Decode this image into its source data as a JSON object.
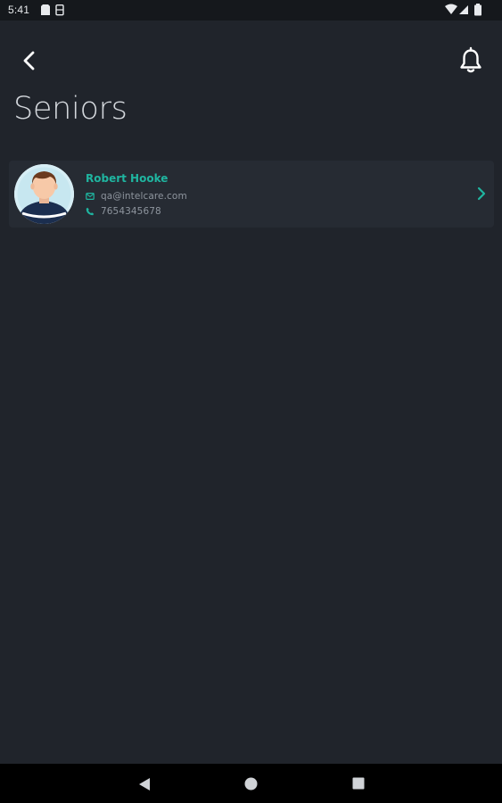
{
  "status_bar": {
    "time": "5:41",
    "left_icons": [
      "sim-card-icon",
      "storage-icon"
    ],
    "right_icons": [
      "wifi-icon",
      "signal-icon",
      "battery-icon"
    ]
  },
  "header": {
    "back_icon": "chevron-left-icon",
    "notification_icon": "bell-icon",
    "title": "Seniors"
  },
  "seniors": [
    {
      "name": "Robert Hooke",
      "email": "qa@intelcare.com",
      "phone": "7654345678",
      "avatar_icon": "person-avatar-icon",
      "chevron_icon": "chevron-right-icon"
    }
  ],
  "nav_bar": {
    "buttons": [
      "back-triangle-icon",
      "home-circle-icon",
      "recents-square-icon"
    ]
  },
  "colors": {
    "background": "#20242b",
    "card": "#262b33",
    "accent": "#1fb5a0",
    "muted_text": "#8e959e",
    "status_bar": "#15181c",
    "nav_bar": "#000000"
  }
}
